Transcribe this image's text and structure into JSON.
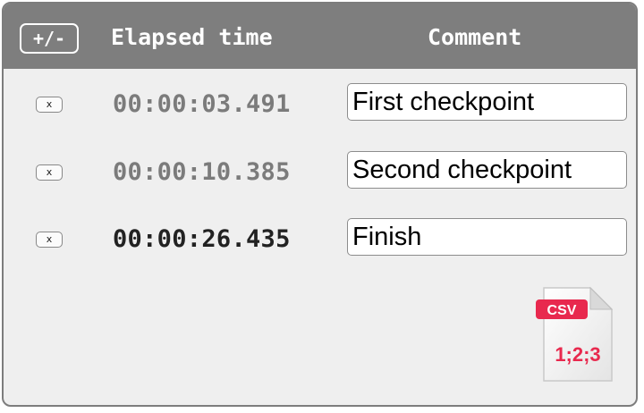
{
  "header": {
    "toggle_label": "+/-",
    "elapsed_label": "Elapsed time",
    "comment_label": "Comment"
  },
  "rows": [
    {
      "delete_label": "x",
      "time": "00:00:03.491",
      "comment": "First checkpoint",
      "current": false
    },
    {
      "delete_label": "x",
      "time": "00:00:10.385",
      "comment": "Second checkpoint",
      "current": false
    },
    {
      "delete_label": "x",
      "time": "00:00:26.435",
      "comment": "Finish",
      "current": true
    }
  ],
  "export": {
    "icon": "csv-file-icon",
    "badge": "CSV",
    "sample": "1;2;3",
    "badge_color": "#e8294e"
  },
  "colors": {
    "header_bg": "#7e7e7e",
    "panel_bg": "#efefef",
    "past_time": "#7b7b7b",
    "current_time": "#222222"
  }
}
